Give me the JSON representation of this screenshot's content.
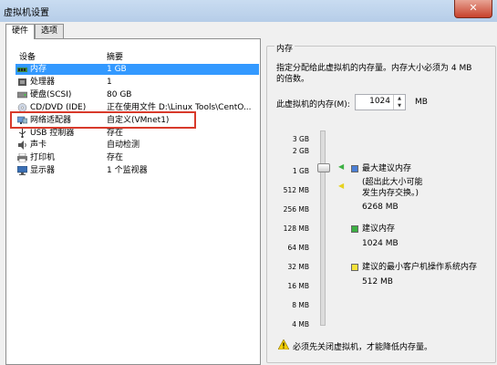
{
  "window": {
    "title": "虚拟机设置",
    "close_label": "✕"
  },
  "tabs": [
    {
      "label": "硬件"
    },
    {
      "label": "选项"
    }
  ],
  "hardware": {
    "col_device": "设备",
    "col_summary": "摘要",
    "rows": [
      {
        "icon": "memory-icon",
        "device": "内存",
        "summary": "1 GB"
      },
      {
        "icon": "processor-icon",
        "device": "处理器",
        "summary": "1"
      },
      {
        "icon": "harddisk-icon",
        "device": "硬盘(SCSI)",
        "summary": "80 GB"
      },
      {
        "icon": "cdrom-icon",
        "device": "CD/DVD (IDE)",
        "summary": "正在使用文件 D:\\Linux Tools\\CentO..."
      },
      {
        "icon": "network-icon",
        "device": "网络适配器",
        "summary": "自定义(VMnet1)"
      },
      {
        "icon": "usb-icon",
        "device": "USB 控制器",
        "summary": "存在"
      },
      {
        "icon": "sound-icon",
        "device": "声卡",
        "summary": "自动检测"
      },
      {
        "icon": "printer-icon",
        "device": "打印机",
        "summary": "存在"
      },
      {
        "icon": "display-icon",
        "device": "显示器",
        "summary": "1 个监视器"
      }
    ]
  },
  "memory": {
    "group_title": "内存",
    "desc_line1": "指定分配给此虚拟机的内存量。内存大小必须为 4 MB",
    "desc_line2": "的倍数。",
    "field_label": "此虚拟机的内存(M):",
    "field_value": "1024",
    "unit": "MB",
    "scale": [
      "3 GB",
      "2 GB",
      "1 GB",
      "512 MB",
      "256 MB",
      "128 MB",
      "64 MB",
      "32 MB",
      "16 MB",
      "8 MB",
      "4 MB"
    ],
    "max_rec": {
      "label": "最大建议内存",
      "note1": "(超出此大小可能",
      "note2": "发生内存交换。)",
      "value": "6268 MB"
    },
    "rec": {
      "label": "建议内存",
      "value": "1024 MB"
    },
    "min_rec": {
      "label": "建议的最小客户机操作系统内存",
      "value": "512 MB"
    },
    "warning": "必须先关闭虚拟机，才能降低内存量。",
    "colors": {
      "blue": "#4a7fd6",
      "green": "#3cb043",
      "yellow": "#f5e23a"
    }
  }
}
